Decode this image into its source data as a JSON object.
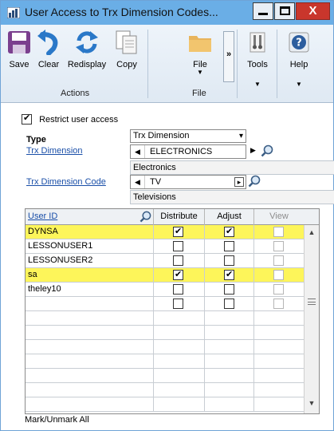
{
  "window": {
    "title": "User Access to Trx Dimension Codes..."
  },
  "titlebar": {
    "close_glyph": "X"
  },
  "ribbon": {
    "buttons": {
      "save": "Save",
      "clear": "Clear",
      "redisplay": "Redisplay",
      "copy": "Copy",
      "file": "File",
      "tools": "Tools",
      "help": "Help"
    },
    "more_glyph": "»",
    "groups": {
      "actions": "Actions",
      "file": "File"
    }
  },
  "form": {
    "restrict_label": "Restrict user access",
    "restrict_checked": true,
    "type_label": "Type",
    "type_value": "Trx Dimension",
    "trx_dimension_label": "Trx Dimension",
    "trx_dimension_value": "ELECTRONICS",
    "trx_dimension_desc": "Electronics",
    "trx_code_label": "Trx Dimension Code",
    "trx_code_value": "TV",
    "trx_code_desc": "Televisions"
  },
  "grid": {
    "headers": {
      "user_id": "User ID",
      "distribute": "Distribute",
      "adjust": "Adjust",
      "view": "View"
    },
    "rows": [
      {
        "user": "DYNSA",
        "distribute": true,
        "adjust": true,
        "highlight": true
      },
      {
        "user": "LESSONUSER1",
        "distribute": false,
        "adjust": false,
        "highlight": false
      },
      {
        "user": "LESSONUSER2",
        "distribute": false,
        "adjust": false,
        "highlight": false
      },
      {
        "user": "sa",
        "distribute": true,
        "adjust": true,
        "highlight": true
      },
      {
        "user": "theley10",
        "distribute": false,
        "adjust": false,
        "highlight": false
      },
      {
        "user": "",
        "distribute": false,
        "adjust": false,
        "highlight": false
      }
    ],
    "empty_rows": 7
  },
  "footer": {
    "mark_all": "Mark/Unmark All"
  },
  "colors": {
    "titlebar": "#6aaee6",
    "highlight": "#fdf55a",
    "link": "#1a4fa8",
    "close": "#c9362c"
  },
  "icons": [
    "app-icon",
    "save-icon",
    "undo-icon",
    "redisplay-icon",
    "copy-icon",
    "folder-icon",
    "tools-icon",
    "help-icon",
    "lookup-icon"
  ]
}
